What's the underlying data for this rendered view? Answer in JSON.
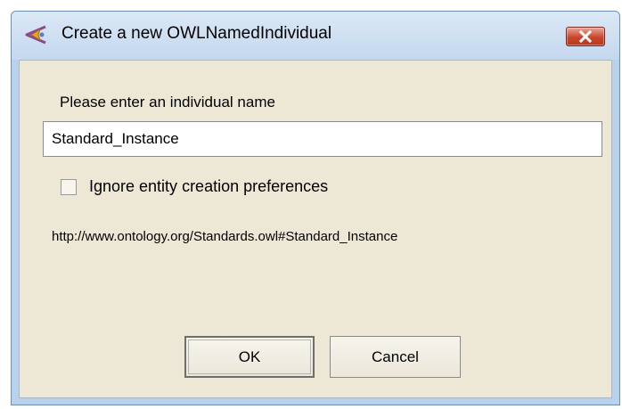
{
  "window": {
    "title": "Create a new OWLNamedIndividual",
    "icon": "protege-app-icon",
    "close_icon": "close-icon"
  },
  "dialog": {
    "prompt": "Please enter an individual name",
    "name_value": "Standard_Instance",
    "ignore_preferences_label": "Ignore entity creation preferences",
    "ignore_preferences_checked": false,
    "iri": "http://www.ontology.org/Standards.owl#Standard_Instance"
  },
  "buttons": {
    "ok": "OK",
    "cancel": "Cancel"
  },
  "colors": {
    "client_bg": "#ede8d6",
    "frame": "#b9d1ea",
    "close_button": "#c9462c"
  }
}
